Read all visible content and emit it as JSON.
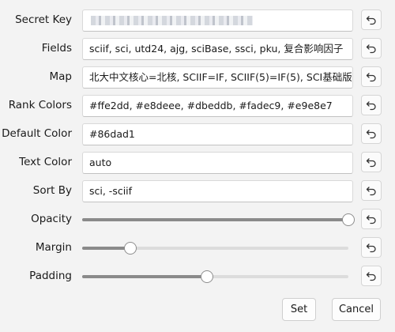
{
  "fields": {
    "secret_key": {
      "label": "Secret Key"
    },
    "fields": {
      "label": "Fields",
      "value": "sciif, sci, utd24, ajg, sciBase, ssci, pku, 复合影响因子"
    },
    "map": {
      "label": "Map",
      "value": "北大中文核心=北核, SCIIF=IF, SCIIF(5)=IF(5), SCI基础版"
    },
    "rank_colors": {
      "label": "Rank Colors",
      "value": "#ffe2dd, #e8deee, #dbeddb, #fadec9, #e9e8e7"
    },
    "default_color": {
      "label": "Default Color",
      "value": "#86dad1"
    },
    "text_color": {
      "label": "Text Color",
      "value": "auto"
    },
    "sort_by": {
      "label": "Sort By",
      "value": "sci, -sciif"
    }
  },
  "sliders": {
    "opacity": {
      "label": "Opacity",
      "fraction": 1.0
    },
    "margin": {
      "label": "Margin",
      "fraction": 0.18
    },
    "padding": {
      "label": "Padding",
      "fraction": 0.47
    }
  },
  "icons": {
    "reset": "undo-arrow-icon"
  },
  "buttons": {
    "set": "Set",
    "cancel": "Cancel"
  }
}
